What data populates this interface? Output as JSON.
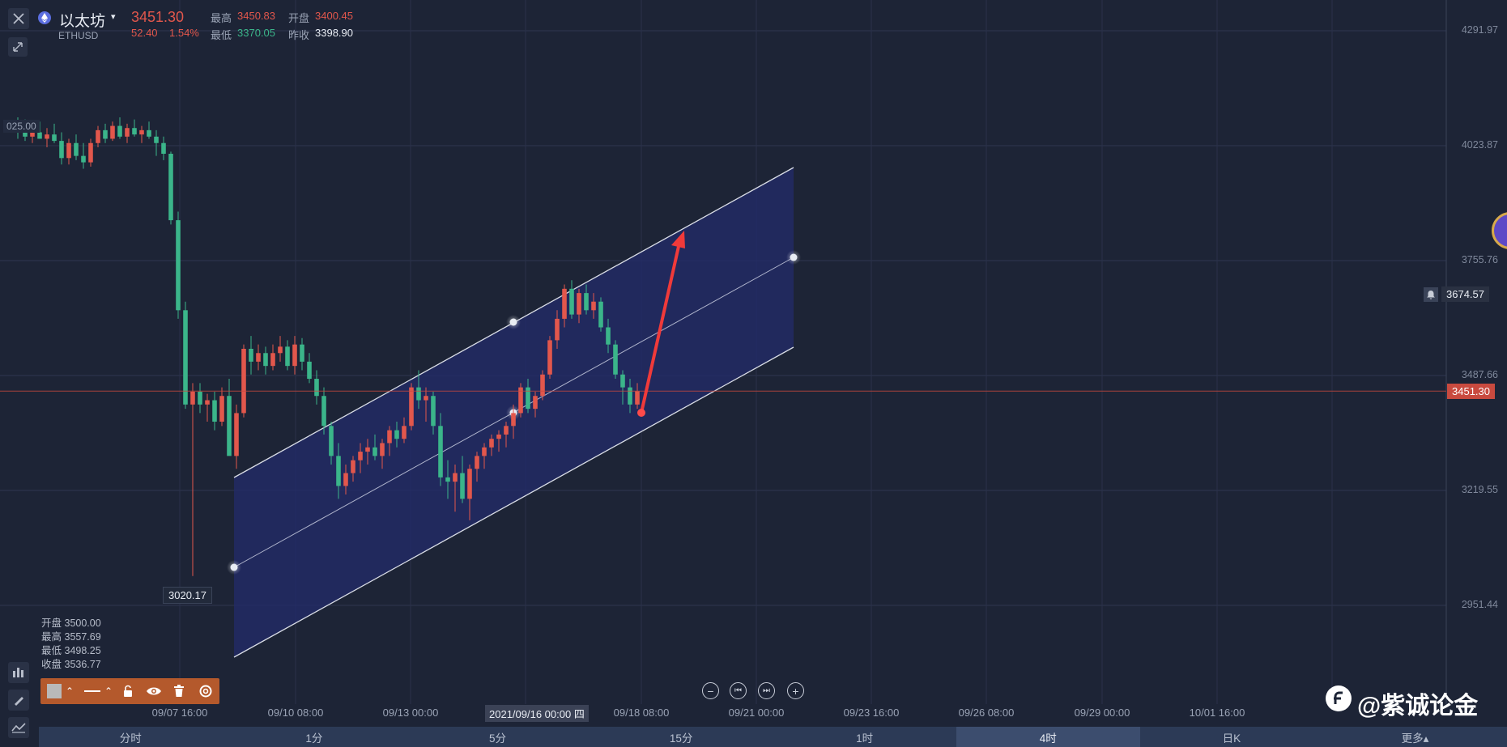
{
  "header": {
    "name": "以太坊",
    "symbol": "ETHUSD",
    "price": "3451.30",
    "change": "52.40",
    "change_pct": "1.54%",
    "high_label": "最高",
    "high_value": "3450.83",
    "open_label": "开盘",
    "open_value": "3400.45",
    "low_label": "最低",
    "low_value": "3370.05",
    "prev_close_label": "昨收",
    "prev_close_value": "3398.90"
  },
  "colors": {
    "up": "#e2574c",
    "down": "#3bb58a",
    "background": "#1d2436",
    "channel_fill": "#232b6b",
    "period_bar": "#2c3a56",
    "toolbar": "#b4592c"
  },
  "left_toolbar": {
    "close_icon": "close-icon",
    "collapse_icon": "collapse-icon",
    "bottom_icons": [
      "indicator-icon",
      "pencil-icon",
      "chart-line-icon"
    ]
  },
  "chart_data": {
    "type": "candlestick",
    "y_ticks": [
      "4291.97",
      "4023.87",
      "3755.76",
      "3487.66",
      "3219.55",
      "2951.44"
    ],
    "y_tick_values": [
      4291.97,
      4023.87,
      3755.76,
      3487.66,
      3219.55,
      2951.44
    ],
    "x_ticks": [
      "09/07 16:00",
      "09/10 08:00",
      "09/13 00:00",
      "09/18 08:00",
      "09/21 00:00",
      "09/23 16:00",
      "09/26 08:00",
      "09/29 00:00",
      "10/01 16:00"
    ],
    "crosshair_time": "2021/09/16 00:00 四",
    "current_price": "3451.30",
    "alert_price": "3674.57",
    "low_marker": "3020.17",
    "partial_left_label": "025.00",
    "candles": [
      [
        4075,
        4090,
        4040,
        4060
      ],
      [
        4060,
        4085,
        4035,
        4045
      ],
      [
        4045,
        4070,
        4030,
        4055
      ],
      [
        4055,
        4080,
        4040,
        4040
      ],
      [
        4040,
        4065,
        4020,
        4050
      ],
      [
        4050,
        4075,
        4030,
        4035
      ],
      [
        4035,
        4055,
        3980,
        3995
      ],
      [
        3995,
        4040,
        3980,
        4030
      ],
      [
        4030,
        4050,
        3990,
        4000
      ],
      [
        4000,
        4030,
        3970,
        3985
      ],
      [
        3985,
        4040,
        3975,
        4030
      ],
      [
        4030,
        4070,
        4020,
        4060
      ],
      [
        4060,
        4075,
        4030,
        4040
      ],
      [
        4040,
        4080,
        4035,
        4070
      ],
      [
        4070,
        4090,
        4040,
        4045
      ],
      [
        4045,
        4075,
        4030,
        4065
      ],
      [
        4065,
        4085,
        4045,
        4050
      ],
      [
        4050,
        4070,
        4030,
        4060
      ],
      [
        4060,
        4080,
        4040,
        4045
      ],
      [
        4045,
        4060,
        4000,
        4030
      ],
      [
        4030,
        4045,
        3990,
        4005
      ],
      [
        4005,
        4010,
        3840,
        3850
      ],
      [
        3850,
        3870,
        3620,
        3640
      ],
      [
        3640,
        3660,
        3410,
        3420
      ],
      [
        3420,
        3470,
        3020,
        3450
      ],
      [
        3450,
        3470,
        3400,
        3420
      ],
      [
        3420,
        3445,
        3380,
        3430
      ],
      [
        3430,
        3450,
        3360,
        3380
      ],
      [
        3380,
        3460,
        3370,
        3440
      ],
      [
        3440,
        3480,
        3390,
        3300
      ],
      [
        3300,
        3420,
        3270,
        3400
      ],
      [
        3400,
        3560,
        3390,
        3550
      ],
      [
        3550,
        3580,
        3490,
        3520
      ],
      [
        3520,
        3560,
        3500,
        3540
      ],
      [
        3540,
        3555,
        3490,
        3510
      ],
      [
        3510,
        3560,
        3500,
        3540
      ],
      [
        3540,
        3580,
        3520,
        3555
      ],
      [
        3555,
        3570,
        3500,
        3510
      ],
      [
        3510,
        3580,
        3490,
        3560
      ],
      [
        3560,
        3575,
        3500,
        3520
      ],
      [
        3520,
        3540,
        3470,
        3480
      ],
      [
        3480,
        3500,
        3420,
        3440
      ],
      [
        3440,
        3460,
        3350,
        3370
      ],
      [
        3370,
        3380,
        3280,
        3300
      ],
      [
        3300,
        3330,
        3200,
        3230
      ],
      [
        3230,
        3280,
        3210,
        3260
      ],
      [
        3260,
        3300,
        3240,
        3290
      ],
      [
        3290,
        3330,
        3260,
        3310
      ],
      [
        3310,
        3340,
        3280,
        3320
      ],
      [
        3320,
        3350,
        3290,
        3300
      ],
      [
        3300,
        3340,
        3270,
        3330
      ],
      [
        3330,
        3370,
        3300,
        3360
      ],
      [
        3360,
        3380,
        3320,
        3340
      ],
      [
        3340,
        3390,
        3330,
        3370
      ],
      [
        3370,
        3470,
        3360,
        3460
      ],
      [
        3460,
        3500,
        3410,
        3430
      ],
      [
        3430,
        3460,
        3380,
        3440
      ],
      [
        3440,
        3450,
        3350,
        3370
      ],
      [
        3370,
        3400,
        3230,
        3250
      ],
      [
        3250,
        3290,
        3200,
        3240
      ],
      [
        3240,
        3280,
        3170,
        3260
      ],
      [
        3260,
        3300,
        3190,
        3200
      ],
      [
        3200,
        3280,
        3150,
        3270
      ],
      [
        3270,
        3310,
        3240,
        3300
      ],
      [
        3300,
        3330,
        3270,
        3320
      ],
      [
        3320,
        3350,
        3300,
        3340
      ],
      [
        3340,
        3360,
        3310,
        3350
      ],
      [
        3350,
        3380,
        3320,
        3370
      ],
      [
        3370,
        3420,
        3340,
        3400
      ],
      [
        3400,
        3470,
        3390,
        3460
      ],
      [
        3460,
        3480,
        3400,
        3410
      ],
      [
        3410,
        3450,
        3390,
        3440
      ],
      [
        3440,
        3500,
        3430,
        3490
      ],
      [
        3490,
        3580,
        3480,
        3570
      ],
      [
        3570,
        3640,
        3550,
        3620
      ],
      [
        3620,
        3700,
        3600,
        3690
      ],
      [
        3690,
        3710,
        3620,
        3630
      ],
      [
        3630,
        3690,
        3610,
        3680
      ],
      [
        3680,
        3700,
        3630,
        3640
      ],
      [
        3640,
        3680,
        3620,
        3660
      ],
      [
        3660,
        3670,
        3590,
        3600
      ],
      [
        3600,
        3620,
        3540,
        3560
      ],
      [
        3560,
        3570,
        3480,
        3490
      ],
      [
        3490,
        3500,
        3420,
        3460
      ],
      [
        3460,
        3480,
        3400,
        3420
      ],
      [
        3420,
        3470,
        3410,
        3451
      ]
    ]
  },
  "ohlc_panel": {
    "open_label": "开盘",
    "open_value": "3500.00",
    "high_label": "最高",
    "high_value": "3557.69",
    "low_label": "最低",
    "low_value": "3498.25",
    "close_label": "收盘",
    "close_value": "3536.77"
  },
  "draw_toolbar": {
    "icons": [
      "color-swatch-icon",
      "caret-up-icon",
      "line-style-icon",
      "caret-up-icon",
      "lock-icon",
      "eye-icon",
      "trash-icon",
      "settings-icon"
    ]
  },
  "zoom_controls": {
    "minus": "−",
    "first": "⏮",
    "last": "⏭",
    "plus": "+"
  },
  "periods": {
    "items": [
      "分时",
      "1分",
      "5分",
      "15分",
      "1时",
      "4时",
      "日K",
      "更多▴"
    ],
    "active": "4时"
  },
  "watermark": {
    "text": "@紫诚论金"
  }
}
